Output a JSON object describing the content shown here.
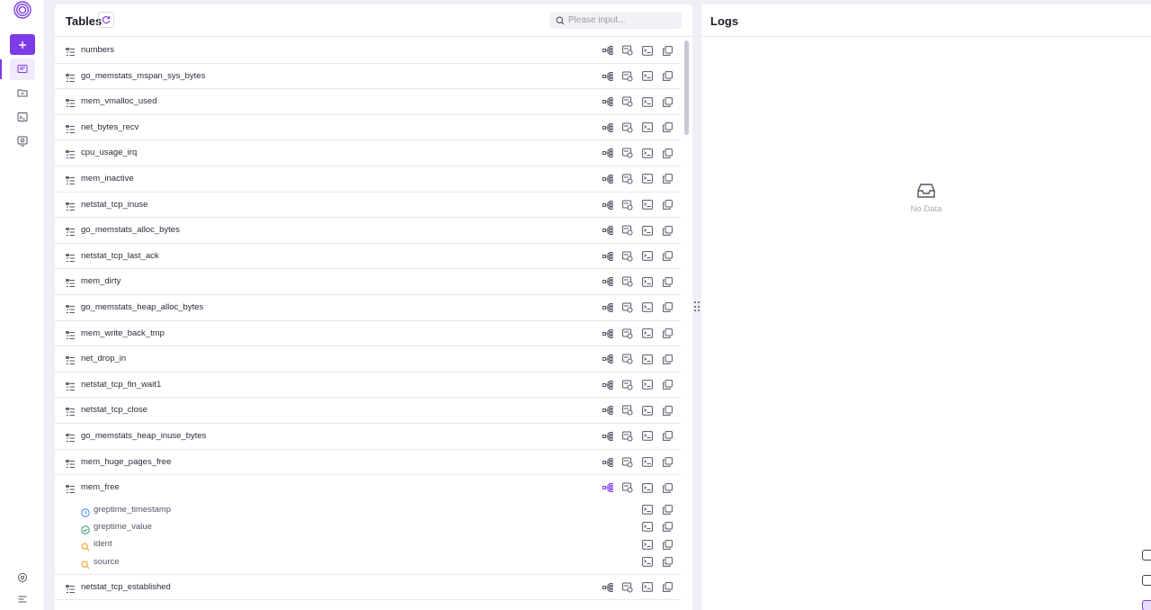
{
  "colors": {
    "accent": "#7d3bea",
    "icon": "#555566",
    "time": "#3b82f6",
    "value": "#22a06b",
    "tag": "#f0a020"
  },
  "tables_panel": {
    "title": "Tables",
    "search_placeholder": "Please input...",
    "tables": [
      {
        "name": "numbers"
      },
      {
        "name": "go_memstats_mspan_sys_bytes"
      },
      {
        "name": "mem_vmalloc_used"
      },
      {
        "name": "net_bytes_recv"
      },
      {
        "name": "cpu_usage_irq"
      },
      {
        "name": "mem_inactive"
      },
      {
        "name": "netstat_tcp_inuse"
      },
      {
        "name": "go_memstats_alloc_bytes"
      },
      {
        "name": "netstat_tcp_last_ack"
      },
      {
        "name": "mem_dirty"
      },
      {
        "name": "go_memstats_heap_alloc_bytes"
      },
      {
        "name": "mem_write_back_tmp"
      },
      {
        "name": "net_drop_in"
      },
      {
        "name": "netstat_tcp_fin_wait1"
      },
      {
        "name": "netstat_tcp_close"
      },
      {
        "name": "go_memstats_heap_inuse_bytes"
      },
      {
        "name": "mem_huge_pages_free"
      },
      {
        "name": "mem_free",
        "expanded": true,
        "columns": [
          {
            "name": "greptime_timestamp",
            "kind": "time"
          },
          {
            "name": "greptime_value",
            "kind": "value"
          },
          {
            "name": "ident",
            "kind": "tag"
          },
          {
            "name": "source",
            "kind": "tag"
          }
        ]
      },
      {
        "name": "netstat_tcp_established"
      }
    ]
  },
  "logs_panel": {
    "title": "Logs",
    "empty_text": "No Data"
  }
}
